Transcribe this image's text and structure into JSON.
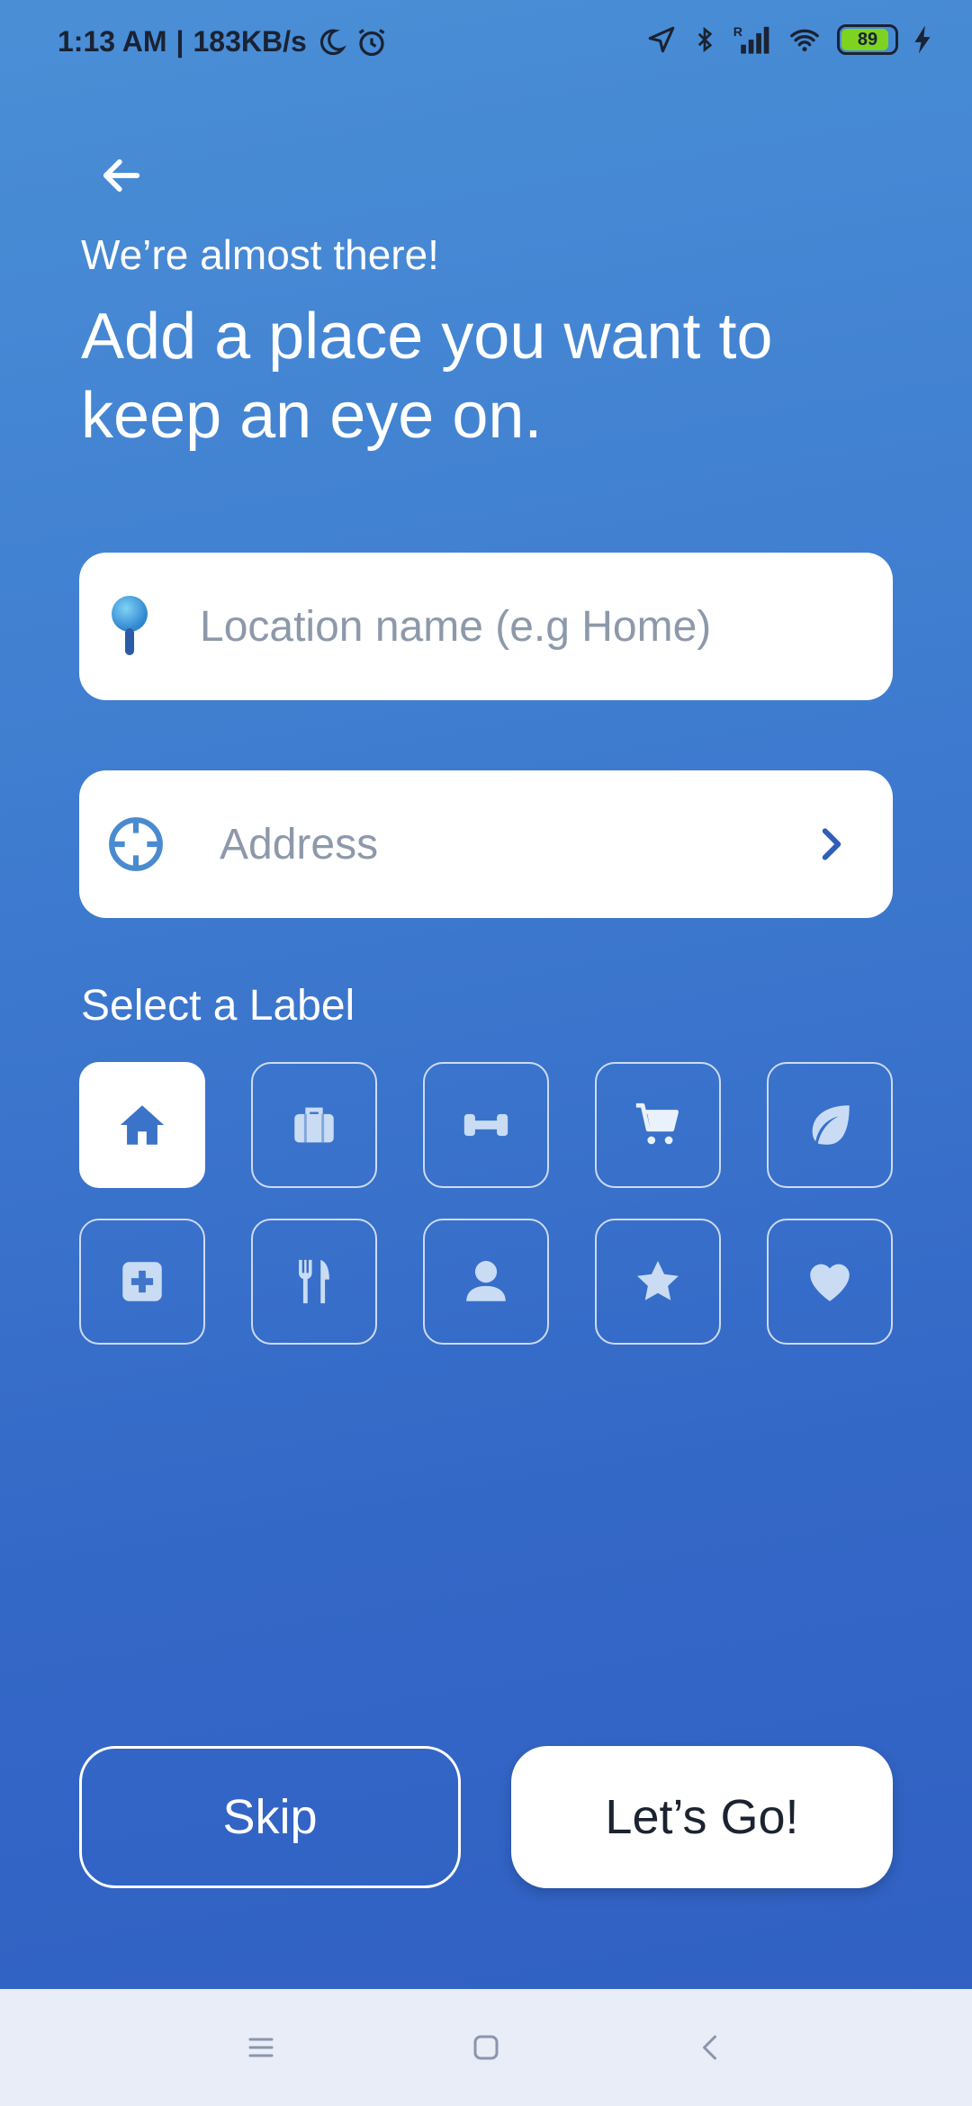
{
  "status_bar": {
    "time": "1:13 AM",
    "separator": "|",
    "network_speed": "183KB/s",
    "battery_level": "89",
    "battery_color": "#7ed321"
  },
  "header": {
    "back_icon": "arrow-left-icon",
    "subtitle": "We’re almost there!",
    "title": "Add a place you want to keep an eye on."
  },
  "form": {
    "location_name": {
      "value": "",
      "placeholder": "Location name (e.g Home)",
      "icon": "map-pin-icon"
    },
    "address": {
      "value": "",
      "placeholder": "Address",
      "icon": "crosshair-icon",
      "trailing_icon": "chevron-right-icon"
    }
  },
  "labels": {
    "heading": "Select a Label",
    "selected": "home",
    "items": [
      {
        "id": "home",
        "icon": "home-icon"
      },
      {
        "id": "work",
        "icon": "briefcase-icon"
      },
      {
        "id": "gym",
        "icon": "dumbbell-icon"
      },
      {
        "id": "shopping",
        "icon": "cart-icon"
      },
      {
        "id": "nature",
        "icon": "leaf-icon"
      },
      {
        "id": "medical",
        "icon": "medical-cross-icon"
      },
      {
        "id": "food",
        "icon": "fork-knife-icon"
      },
      {
        "id": "person",
        "icon": "person-icon"
      },
      {
        "id": "favorite",
        "icon": "star-icon"
      },
      {
        "id": "love",
        "icon": "heart-icon"
      }
    ]
  },
  "actions": {
    "skip_label": "Skip",
    "go_label": "Let’s Go!"
  },
  "colors": {
    "accent": "#3f7dd0",
    "icon_blue": "#3a73c7"
  },
  "nav_bar": {
    "items": [
      "menu-icon",
      "home-square-icon",
      "back-chevron-icon"
    ]
  }
}
